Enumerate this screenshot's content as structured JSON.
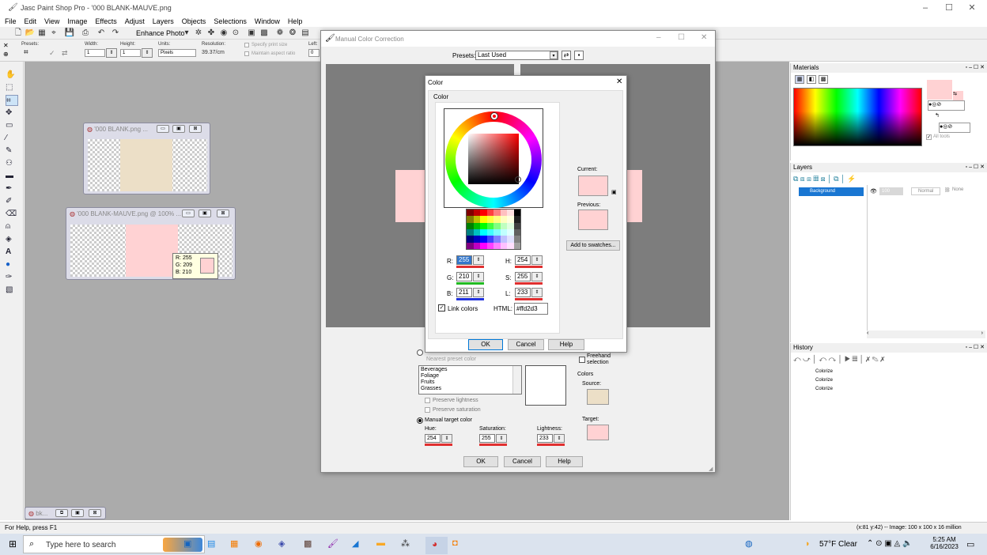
{
  "app": {
    "title": "Jasc Paint Shop Pro - '000 BLANK-MAUVE.png",
    "menu": [
      "File",
      "Edit",
      "View",
      "Image",
      "Effects",
      "Adjust",
      "Layers",
      "Objects",
      "Selections",
      "Window",
      "Help"
    ],
    "enhance_photo": "Enhance Photo"
  },
  "options": {
    "presets_label": "Presets:",
    "width_label": "Width:",
    "width_value": "1",
    "height_label": "Height:",
    "height_value": "1",
    "units_label": "Units:",
    "units_value": "Pixels",
    "resolution_label": "Resolution:",
    "resolution_value": "39.37/cm",
    "print_size": "Specify print size",
    "aspect": "Maintain aspect ratio",
    "left_label": "Left:",
    "left_value": "0"
  },
  "docs": {
    "blank": {
      "title": "'000 BLANK.png ..."
    },
    "mauve": {
      "title": "'000 BLANK-MAUVE.png @ 100% ..."
    },
    "minimized": {
      "title": "bk..."
    },
    "tooltip": {
      "r": "R: 255",
      "g": "G: 209",
      "b": "B: 210"
    }
  },
  "mcc": {
    "title": "Manual Color Correction",
    "presets_label": "Presets:",
    "presets_value": "Last Used",
    "nearest": "Nearest preset color",
    "list": [
      "Beverages",
      "Foliage",
      "Fruits",
      "Grasses"
    ],
    "preserve_lightness": "Preserve lightness",
    "preserve_saturation": "Preserve saturation",
    "freehand": "Freehand selection",
    "colors_label": "Colors",
    "source_label": "Source:",
    "target_label": "Target:",
    "manual_target": "Manual target color",
    "hue_label": "Hue:",
    "hue_value": "254",
    "sat_label": "Saturation:",
    "sat_value": "255",
    "light_label": "Lightness:",
    "light_value": "233",
    "ok": "OK",
    "cancel": "Cancel",
    "help": "Help",
    "source_color": "#ecdfc7",
    "target_color": "#ffd2d3"
  },
  "color_dialog": {
    "title": "Color",
    "group_label": "Color",
    "current_label": "Current:",
    "previous_label": "Previous:",
    "add_swatches": "Add to swatches...",
    "r_label": "R:",
    "r_value": "255",
    "g_label": "G:",
    "g_value": "210",
    "b_label": "B:",
    "b_value": "211",
    "h_label": "H:",
    "h_value": "254",
    "s_label": "S:",
    "s_value": "255",
    "l_label": "L:",
    "l_value": "233",
    "link_colors": "Link colors",
    "html_label": "HTML:",
    "html_value": "#ffd2d3",
    "ok": "OK",
    "cancel": "Cancel",
    "help": "Help",
    "current_color": "#ffd2d3",
    "previous_color": "#ffd2d3"
  },
  "materials": {
    "title": "Materials",
    "all_tools": "All tools"
  },
  "layers": {
    "title": "Layers",
    "layer_name": "Background",
    "opacity": "100",
    "blend": "Normal",
    "none": "None"
  },
  "history": {
    "title": "History",
    "items": [
      "Colorize",
      "Colorize",
      "Colorize"
    ]
  },
  "status": {
    "left": "For Help, press F1",
    "right": "(x:81 y:42) -- Image: 100 x 100 x 16 million"
  },
  "taskbar": {
    "search": "Type here to search",
    "weather": "57°F  Clear",
    "time": "5:25 AM",
    "date": "6/16/2023"
  }
}
